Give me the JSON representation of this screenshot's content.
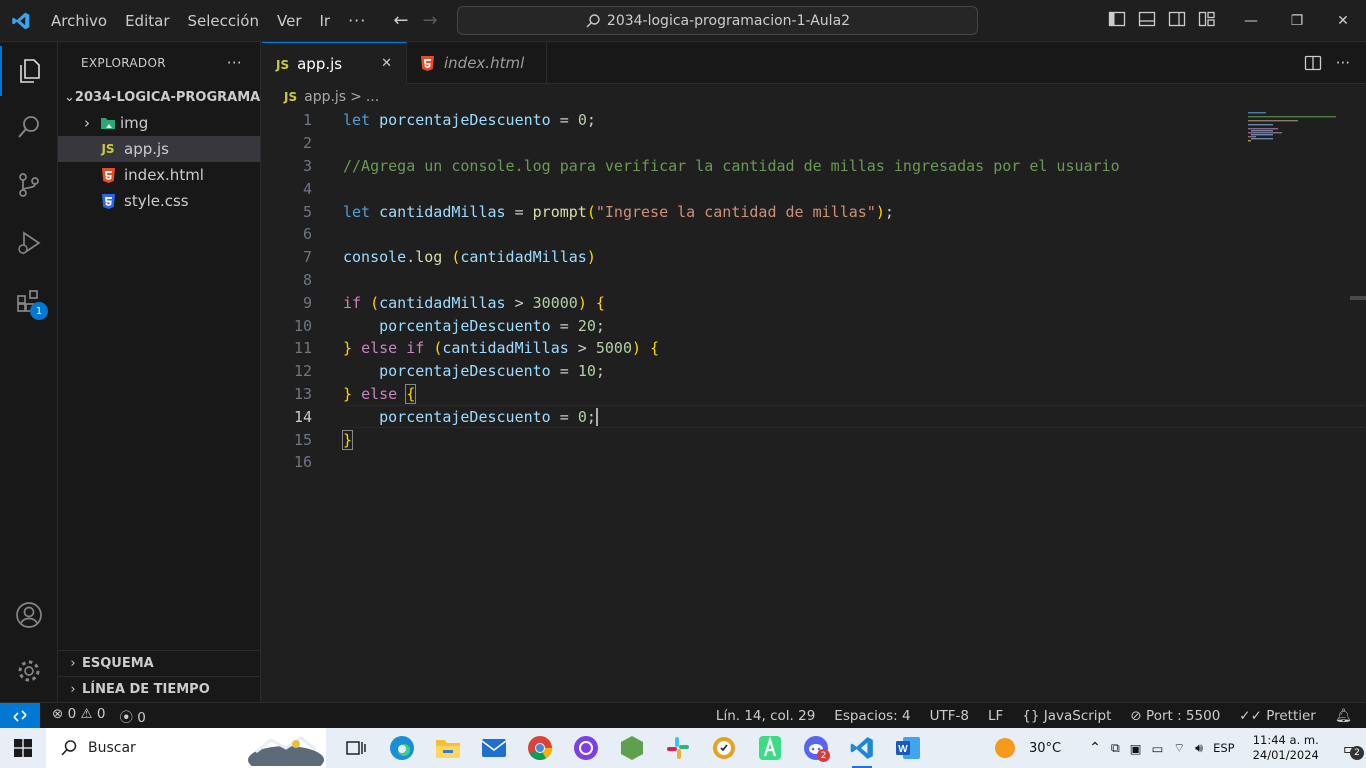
{
  "titlebar": {
    "menu": [
      "Archivo",
      "Editar",
      "Selección",
      "Ver",
      "Ir"
    ],
    "more": "···",
    "command_center": "2034-logica-programacion-1-Aula2"
  },
  "activity": {
    "extensions_badge": "1"
  },
  "sidebar": {
    "title": "EXPLORADOR",
    "more": "···",
    "folder": "2034-LOGICA-PROGRAMA...",
    "items": [
      {
        "label": "img",
        "type": "folder"
      },
      {
        "label": "app.js",
        "type": "js",
        "icon_text": "JS"
      },
      {
        "label": "index.html",
        "type": "html"
      },
      {
        "label": "style.css",
        "type": "css"
      }
    ],
    "outline": "ESQUEMA",
    "timeline": "LÍNEA DE TIEMPO"
  },
  "tabs": [
    {
      "label": "app.js",
      "icon_text": "JS",
      "close": "✕"
    },
    {
      "label": "index.html"
    }
  ],
  "breadcrumb": {
    "icon_text": "JS",
    "file": "app.js",
    "sep": ">",
    "rest": "..."
  },
  "editor": {
    "line_numbers": [
      "1",
      "2",
      "3",
      "4",
      "5",
      "6",
      "7",
      "8",
      "9",
      "10",
      "11",
      "12",
      "13",
      "14",
      "15",
      "16"
    ],
    "current_line": 14
  },
  "statusbar": {
    "errors": "0",
    "warnings": "0",
    "ports": "0",
    "position": "Lín. 14, col. 29",
    "spaces": "Espacios: 4",
    "encoding": "UTF-8",
    "eol": "LF",
    "language": "JavaScript",
    "port": "Port : 5500",
    "prettier": "Prettier"
  },
  "taskbar": {
    "search": "Buscar",
    "weather": "30°C",
    "lang": "ESP",
    "time": "11:44 a. m.",
    "date": "24/01/2024",
    "notifications": "2",
    "discord_badge": "2"
  },
  "colors": {
    "accent": "#0078d4",
    "keyword": "#c586c0",
    "declaration": "#569cd6",
    "variable": "#9cdcfe",
    "function": "#dcdcaa",
    "number": "#b5cea8",
    "string": "#ce9178",
    "comment": "#6a9955"
  }
}
